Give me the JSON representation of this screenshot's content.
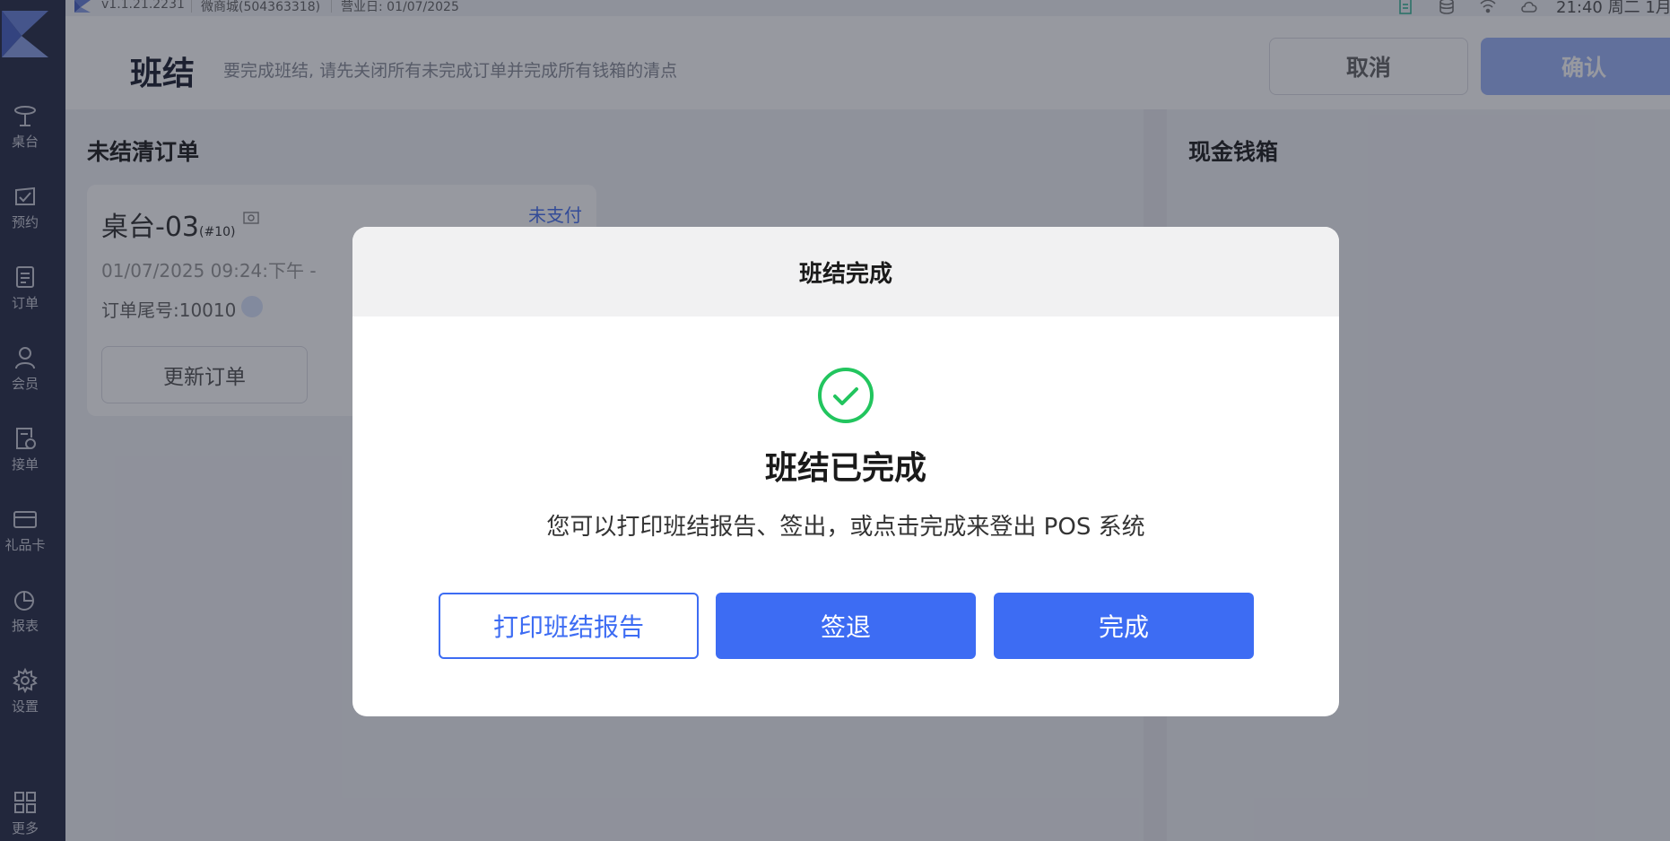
{
  "status_bar": {
    "version": "v1.1.21.2231",
    "store": "微商城(504363318)",
    "business_day": "营业日: 01/07/2025",
    "clock": "21:40 周二 1月"
  },
  "sidebar": {
    "items": [
      {
        "label": "桌台",
        "icon": "table-icon"
      },
      {
        "label": "预约",
        "icon": "reservation-icon"
      },
      {
        "label": "订单",
        "icon": "order-icon"
      },
      {
        "label": "会员",
        "icon": "member-icon"
      },
      {
        "label": "接单",
        "icon": "accept-order-icon"
      },
      {
        "label": "礼品卡",
        "icon": "gift-card-icon"
      },
      {
        "label": "报表",
        "icon": "report-icon"
      },
      {
        "label": "设置",
        "icon": "settings-icon"
      },
      {
        "label": "更多",
        "icon": "more-icon"
      }
    ]
  },
  "header": {
    "title": "班结",
    "subtitle": "要完成班结, 请先关闭所有未完成订单并完成所有钱箱的清点",
    "cancel_label": "取消",
    "confirm_label": "确认"
  },
  "unsettled": {
    "title": "未结清订单",
    "order": {
      "table": "桌台-03",
      "table_no": "(#10)",
      "status": "未支付",
      "time": "01/07/2025 09:24:下午   -",
      "tail": "订单尾号:10010",
      "update_label": "更新订单"
    }
  },
  "cash_drawer": {
    "title": "现金钱箱"
  },
  "modal": {
    "header": "班结完成",
    "title": "班结已完成",
    "description": "您可以打印班结报告、签出，或点击完成来登出 POS 系统",
    "print_label": "打印班结报告",
    "signout_label": "签退",
    "done_label": "完成"
  },
  "colors": {
    "sidebar_bg": "#2b3049",
    "primary": "#3d6cf3",
    "success": "#22c55e"
  }
}
